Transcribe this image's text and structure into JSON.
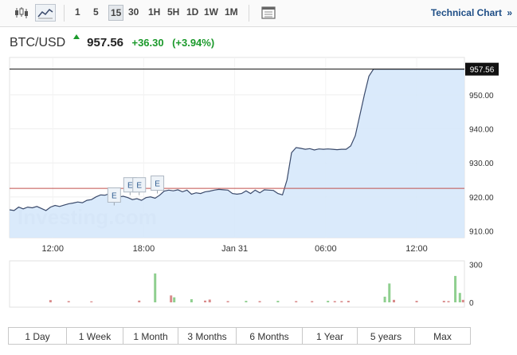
{
  "toolbar": {
    "candles_icon": "candlestick-icon",
    "line_icon": "line-chart-icon",
    "timeframes": [
      "1",
      "5",
      "15",
      "30",
      "1H",
      "5H",
      "1D",
      "1W",
      "1M"
    ],
    "active_timeframe": "15",
    "calendar_icon": "calendar-icon",
    "tech_link": "Technical Chart",
    "tech_arrow": "»"
  },
  "header": {
    "pair": "BTC/USD",
    "arrow": "up-arrow-icon",
    "last": "957.56",
    "change": "+36.30",
    "change_pct": "(+3.94%)"
  },
  "watermark": "Investing.com",
  "range_buttons": [
    "1 Day",
    "1 Week",
    "1 Month",
    "3 Months",
    "6 Months",
    "1 Year",
    "5 years",
    "Max"
  ],
  "colors": {
    "line": "#3a4a6b",
    "area": "#d6e8fb",
    "up": "#1c9a2c",
    "ref_line": "#c0504d",
    "vol_up": "#8fcf8f",
    "vol_down": "#d98b8b"
  },
  "chart_data": {
    "type": "area",
    "title": "BTC/USD",
    "xlabel": "",
    "ylabel": "",
    "x_ticks": [
      "12:00",
      "18:00",
      "Jan 31",
      "06:00",
      "12:00"
    ],
    "y_ticks": [
      910,
      920,
      930,
      940,
      950
    ],
    "y_tick_labels": [
      "910.00",
      "920.00",
      "930.00",
      "940.00",
      "950.00"
    ],
    "ylim": [
      908,
      961
    ],
    "last_price": 957.56,
    "last_label": "957.56",
    "previous_close": 922.5,
    "events_label": "E",
    "events": [
      {
        "x": 0.23,
        "y": 917.5
      },
      {
        "x": 0.265,
        "y": 920.5
      },
      {
        "x": 0.285,
        "y": 920.5
      },
      {
        "x": 0.325,
        "y": 921.0
      }
    ],
    "series": [
      {
        "x": [
          0,
          0.01,
          0.02,
          0.03,
          0.04,
          0.05,
          0.06,
          0.07,
          0.08,
          0.09,
          0.1,
          0.11,
          0.12,
          0.13,
          0.14,
          0.15,
          0.16,
          0.17,
          0.18,
          0.19,
          0.2,
          0.21,
          0.22,
          0.23,
          0.24,
          0.25,
          0.26,
          0.27,
          0.28,
          0.29,
          0.3,
          0.31,
          0.32,
          0.33,
          0.34,
          0.35,
          0.36,
          0.37,
          0.38,
          0.39,
          0.4,
          0.41,
          0.42,
          0.43,
          0.44,
          0.45,
          0.46,
          0.47,
          0.48,
          0.49,
          0.5,
          0.51,
          0.52,
          0.53,
          0.54,
          0.55,
          0.56,
          0.57,
          0.58,
          0.59,
          0.6,
          0.61,
          0.62,
          0.63,
          0.64,
          0.65,
          0.66,
          0.67,
          0.68,
          0.69,
          0.7,
          0.71,
          0.72,
          0.73,
          0.74,
          0.75,
          0.76,
          0.77,
          0.78,
          0.79,
          0.8,
          0.81,
          0.82,
          0.83,
          0.84,
          0.85,
          0.86,
          0.87,
          0.88,
          0.89,
          0.9,
          0.91,
          0.92,
          0.93,
          0.94,
          0.95,
          0.96,
          0.97,
          0.98,
          0.99,
          1.0
        ],
        "values": [
          916.2,
          916.0,
          917.0,
          916.5,
          917.0,
          916.8,
          917.2,
          916.6,
          916.0,
          917.0,
          917.5,
          917.2,
          917.6,
          918.0,
          918.2,
          918.5,
          918.3,
          919.0,
          919.2,
          920.0,
          920.6,
          920.5,
          921.0,
          920.3,
          920.0,
          920.2,
          919.8,
          919.2,
          919.5,
          919.0,
          919.8,
          920.0,
          919.6,
          920.5,
          921.7,
          922.0,
          921.8,
          922.1,
          921.5,
          922.0,
          920.8,
          921.2,
          921.0,
          921.5,
          921.7,
          922.0,
          922.2,
          922.1,
          922.0,
          921.0,
          920.8,
          921.0,
          921.8,
          921.0,
          922.0,
          921.2,
          922.1,
          922.0,
          921.9,
          921.0,
          920.6,
          925.0,
          933.0,
          934.5,
          934.3,
          934.0,
          934.2,
          933.8,
          934.1,
          934.0,
          934.1,
          934.0,
          933.9,
          934.0,
          934.0,
          935.0,
          938.0,
          944.0,
          950.0,
          955.5,
          957.56,
          957.56,
          957.56,
          957.56,
          957.56,
          957.56,
          957.56,
          957.56,
          957.56,
          957.56,
          957.56,
          957.56,
          957.56,
          957.56,
          957.56,
          957.56,
          957.56,
          957.56,
          957.56,
          957.56,
          957.56
        ]
      }
    ],
    "volume": {
      "y_ticks": [
        0,
        300
      ],
      "y_tick_labels": [
        "0",
        "300"
      ],
      "ymax": 330,
      "bars": [
        {
          "x": 0.09,
          "v": 18,
          "dir": "down"
        },
        {
          "x": 0.13,
          "v": 10,
          "dir": "down"
        },
        {
          "x": 0.18,
          "v": 8,
          "dir": "down"
        },
        {
          "x": 0.285,
          "v": 14,
          "dir": "down"
        },
        {
          "x": 0.32,
          "v": 230,
          "dir": "up"
        },
        {
          "x": 0.355,
          "v": 55,
          "dir": "down"
        },
        {
          "x": 0.362,
          "v": 40,
          "dir": "up"
        },
        {
          "x": 0.4,
          "v": 25,
          "dir": "up"
        },
        {
          "x": 0.43,
          "v": 14,
          "dir": "down"
        },
        {
          "x": 0.44,
          "v": 22,
          "dir": "down"
        },
        {
          "x": 0.48,
          "v": 10,
          "dir": "down"
        },
        {
          "x": 0.52,
          "v": 12,
          "dir": "up"
        },
        {
          "x": 0.55,
          "v": 10,
          "dir": "down"
        },
        {
          "x": 0.59,
          "v": 12,
          "dir": "up"
        },
        {
          "x": 0.63,
          "v": 10,
          "dir": "down"
        },
        {
          "x": 0.665,
          "v": 10,
          "dir": "down"
        },
        {
          "x": 0.7,
          "v": 12,
          "dir": "up"
        },
        {
          "x": 0.715,
          "v": 10,
          "dir": "down"
        },
        {
          "x": 0.73,
          "v": 10,
          "dir": "down"
        },
        {
          "x": 0.745,
          "v": 12,
          "dir": "down"
        },
        {
          "x": 0.825,
          "v": 45,
          "dir": "up"
        },
        {
          "x": 0.835,
          "v": 150,
          "dir": "up"
        },
        {
          "x": 0.845,
          "v": 20,
          "dir": "down"
        },
        {
          "x": 0.895,
          "v": 12,
          "dir": "down"
        },
        {
          "x": 0.955,
          "v": 12,
          "dir": "down"
        },
        {
          "x": 0.965,
          "v": 10,
          "dir": "down"
        },
        {
          "x": 0.98,
          "v": 210,
          "dir": "up"
        },
        {
          "x": 0.99,
          "v": 75,
          "dir": "up"
        },
        {
          "x": 0.997,
          "v": 20,
          "dir": "down"
        }
      ]
    }
  }
}
